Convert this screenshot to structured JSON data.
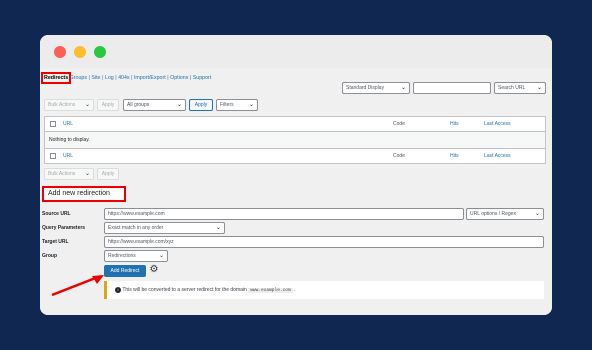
{
  "nav": {
    "current": "Redirects",
    "links": [
      "Groups",
      "Site",
      "Log",
      "404s",
      "Import/Export",
      "Options",
      "Support"
    ]
  },
  "toolbar": {
    "display_select": "Standard Display",
    "search_value": "",
    "search_button": "Search URL",
    "bulk_actions": "Bulk Actions",
    "apply": "Apply",
    "groups_select": "All groups",
    "apply2": "Apply",
    "filters": "Filters"
  },
  "table": {
    "columns": [
      "URL",
      "Code",
      "Hits",
      "Last Access"
    ],
    "empty": "Nothing to display."
  },
  "bottom_bar": {
    "bulk_actions": "Bulk Actions",
    "apply": "Apply"
  },
  "add": {
    "heading": "Add new redirection",
    "source_label": "Source URL",
    "source_value": "https://www.example.com",
    "url_options": "URL options / Regex",
    "query_label": "Query Parameters",
    "query_value": "Exact match in any order",
    "target_label": "Target URL",
    "target_value": "https://www.example.com/xyz",
    "group_label": "Group",
    "group_value": "Redirections",
    "submit": "Add Redirect"
  },
  "notice": {
    "before": "This will be converted to a server redirect for the domain",
    "domain": "www.example.com",
    "after": "."
  },
  "colors": {
    "accent": "#2271b1",
    "highlight": "#ee0000",
    "background": "#0f2751"
  }
}
